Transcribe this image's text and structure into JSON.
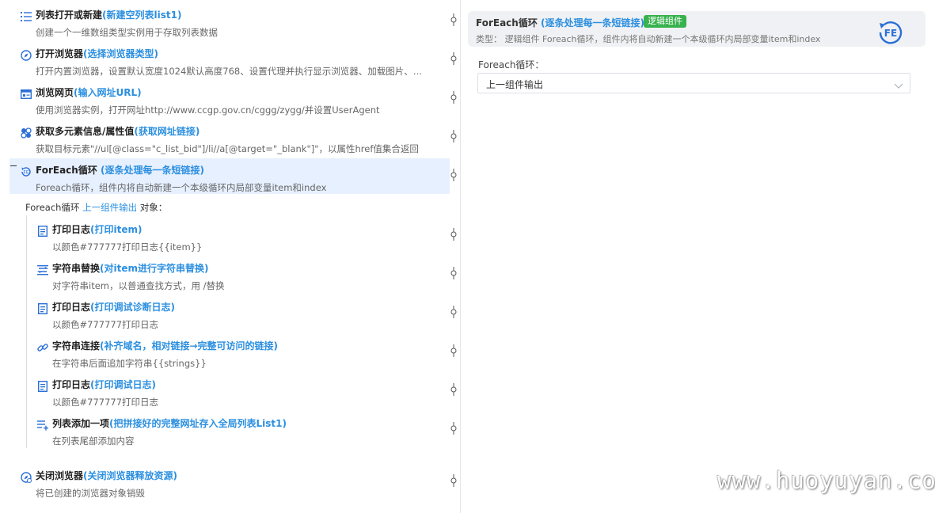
{
  "steps": [
    {
      "title": "列表打开或新建",
      "alias": "(新建空列表list1)",
      "desc": "创建一个一维数组类型实例用于存取列表数据",
      "icon": "list-icon"
    },
    {
      "title": "打开浏览器",
      "alias": "(选择浏览器类型)",
      "desc": "打开内置浏览器，设置默认宽度1024默认高度768、设置代理并执行显示浏览器、加载图片、…",
      "icon": "browser-open-icon"
    },
    {
      "title": "浏览网页",
      "alias": "(输入网址URL)",
      "desc": "使用浏览器实例，打开网址http://www.ccgp.gov.cn/cggg/zygg/并设置UserAgent",
      "icon": "webpage-icon"
    },
    {
      "title": "获取多元素信息/属性值",
      "alias": "(获取网址链接)",
      "desc": "获取目标元素\"//ul[@class=\"c_list_bid\"]/li//a[@target=\"_blank\"]\"，以属性href值集合返回",
      "icon": "multi-element-icon"
    },
    {
      "title": "ForEach循环",
      "alias": "(逐条处理每一条短链接)",
      "desc": "Foreach循环，组件内将自动新建一个本级循环内局部变量item和index",
      "icon": "foreach-icon"
    }
  ],
  "foreach_target": {
    "prefix": "Foreach循环",
    "link": "上一组件输出",
    "suffix": "对象："
  },
  "nested_steps": [
    {
      "title": "打印日志",
      "alias": "(打印item)",
      "desc": "以颜色#777777打印日志{{item}}",
      "icon": "print-log-icon"
    },
    {
      "title": "字符串替换",
      "alias": "(对item进行字符串替换)",
      "desc": "对字符串item，以普通查找方式，用 /替换",
      "icon": "string-replace-icon"
    },
    {
      "title": "打印日志",
      "alias": "(打印调试诊断日志)",
      "desc": "以颜色#777777打印日志",
      "icon": "print-log-icon"
    },
    {
      "title": "字符串连接",
      "alias": "(补齐域名，相对链接→完整可访问的链接)",
      "desc": "在字符串后面追加字符串{{strings}}",
      "icon": "string-concat-icon"
    },
    {
      "title": "打印日志",
      "alias": "(打印调试日志)",
      "desc": "以颜色#777777打印日志",
      "icon": "print-log-icon"
    },
    {
      "title": "列表添加一项",
      "alias": "(把拼接好的完整网址存入全局列表List1)",
      "desc": "在列表尾部添加内容",
      "icon": "list-add-icon"
    }
  ],
  "final_step": {
    "title": "关闭浏览器",
    "alias": "(关闭浏览器释放资源)",
    "desc": "将已创建的浏览器对象销毁",
    "icon": "browser-close-icon"
  },
  "detail": {
    "title": "ForEach循环",
    "alias": "(逐条处理每一条短链接)",
    "badge": "逻辑组件",
    "desc": "类型： 逻辑组件 Foreach循环，组件内将自动新建一个本级循环内局部变量item和index",
    "field_label": "Foreach循环：",
    "field_value": "上一组件输出"
  },
  "watermark": "www.huoyuyan.com",
  "colors": {
    "accent": "#2b8fe0",
    "badge": "#37b24d",
    "selected_bg": "#e7f0ff"
  }
}
